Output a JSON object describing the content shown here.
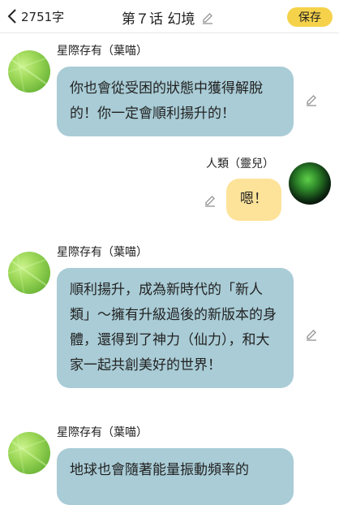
{
  "header": {
    "word_count": "2751字",
    "title": "第７话 幻境",
    "save_label": "保存"
  },
  "messages": [
    {
      "speaker": "星際存有（葉喵）",
      "text": "你也會從受困的狀態中獲得解脫的！你一定會順利揚升的！"
    },
    {
      "speaker": "人類（靈兒）",
      "text": "嗯！"
    },
    {
      "speaker": "星際存有（葉喵）",
      "text": "順利揚升，成為新時代的「新人類」～擁有升級過後的新版本的身體，還得到了神力（仙力），和大家一起共創美好的世界！"
    },
    {
      "speaker": "星際存有（葉喵）",
      "text": "地球也會隨著能量振動頻率的"
    }
  ],
  "colors": {
    "save_button": "#f5d24a",
    "left_bubble": "#a9ccd6",
    "right_bubble": "#fde39a"
  },
  "icons": [
    "chevron-left-icon",
    "pencil-icon"
  ]
}
